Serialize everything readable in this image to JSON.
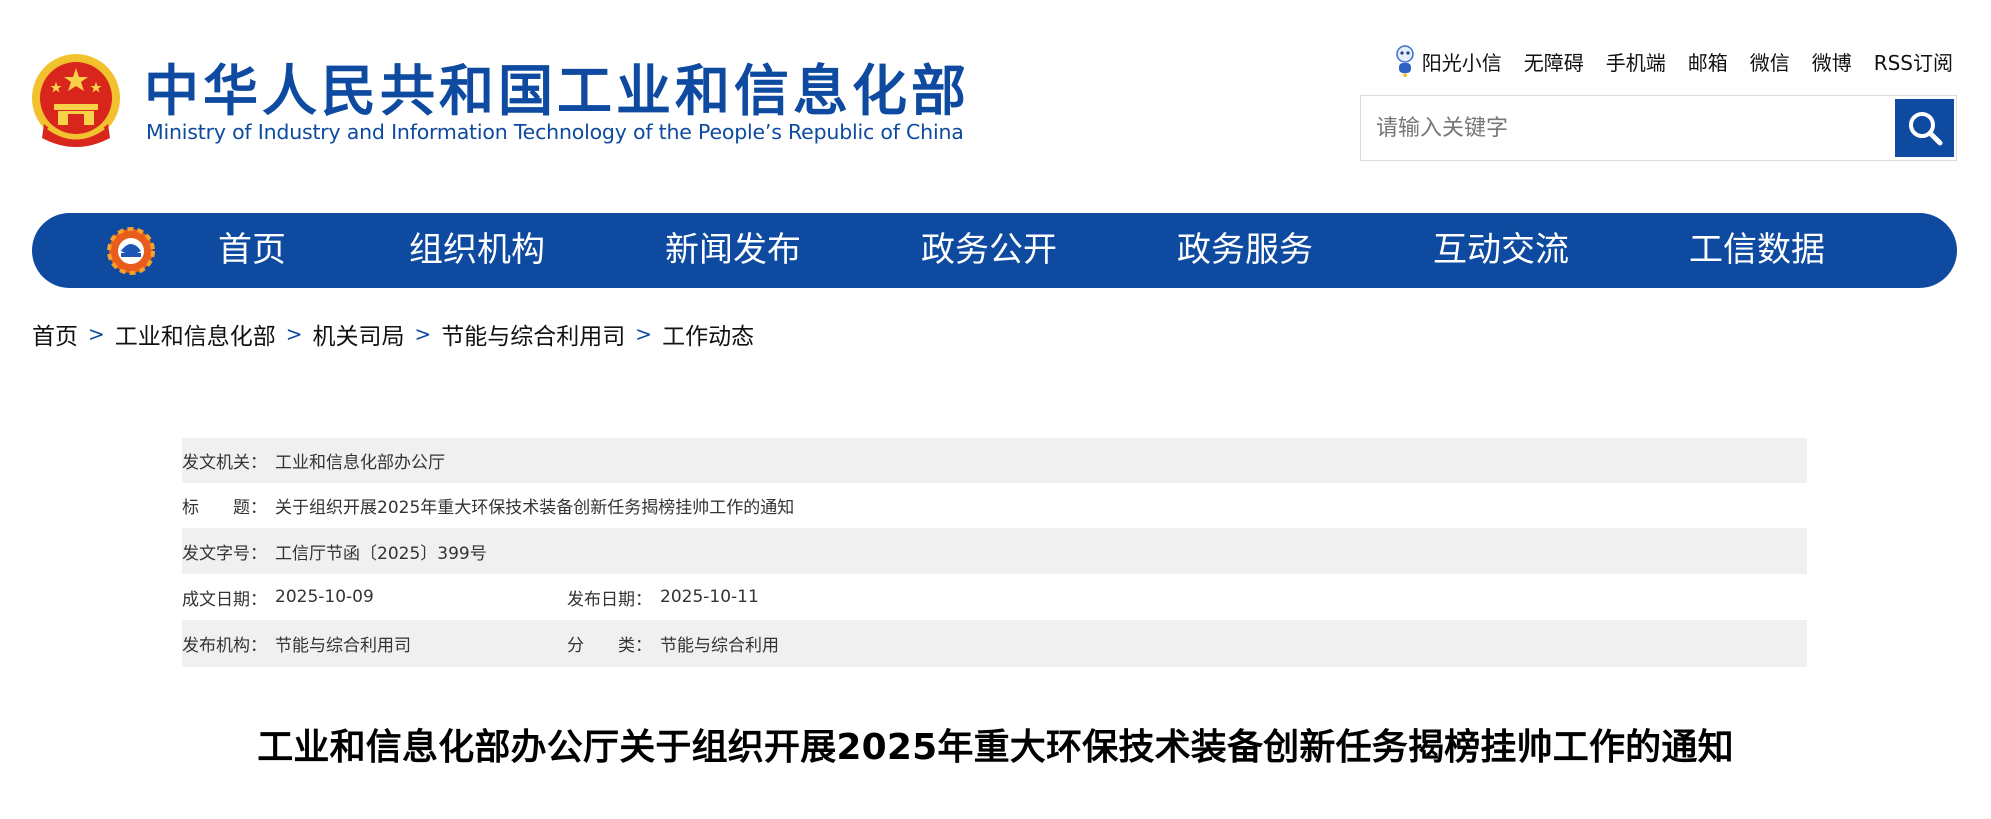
{
  "header": {
    "site_title": "中华人民共和国工业和信息化部",
    "site_subtitle": "Ministry of Industry and Information Technology of the People’s Republic of China",
    "emblem_icon": "national-emblem-icon",
    "top_links": [
      "阳光小信",
      "无障碍",
      "手机端",
      "邮箱",
      "微信",
      "微博",
      "RSS订阅"
    ],
    "search": {
      "placeholder": "请输入关键字",
      "icon": "search-icon"
    },
    "brand_color": "#0d4aa0"
  },
  "nav": {
    "logo_icon": "miit-logo-icon",
    "items": [
      "首页",
      "组织机构",
      "新闻发布",
      "政务公开",
      "政务服务",
      "互动交流",
      "工信数据"
    ]
  },
  "breadcrumb": [
    "首页",
    "工业和信息化部",
    "机关司局",
    "节能与综合利用司",
    "工作动态"
  ],
  "info": {
    "issuer_label": "发文机关：",
    "issuer": "工业和信息化部办公厅",
    "title_label": "标　　题：",
    "title": "关于组织开展2025年重大环保技术装备创新任务揭榜挂帅工作的通知",
    "doc_no_label": "发文字号：",
    "doc_no": "工信厅节函〔2025〕399号",
    "created_label": "成文日期：",
    "created": "2025-10-09",
    "published_label": "发布日期：",
    "published": "2025-10-11",
    "publisher_label": "发布机构：",
    "publisher": "节能与综合利用司",
    "category_label": "分　　类：",
    "category": "节能与综合利用"
  },
  "article": {
    "title": "工业和信息化部办公厅关于组织开展2025年重大环保技术装备创新任务揭榜挂帅工作的通知"
  }
}
